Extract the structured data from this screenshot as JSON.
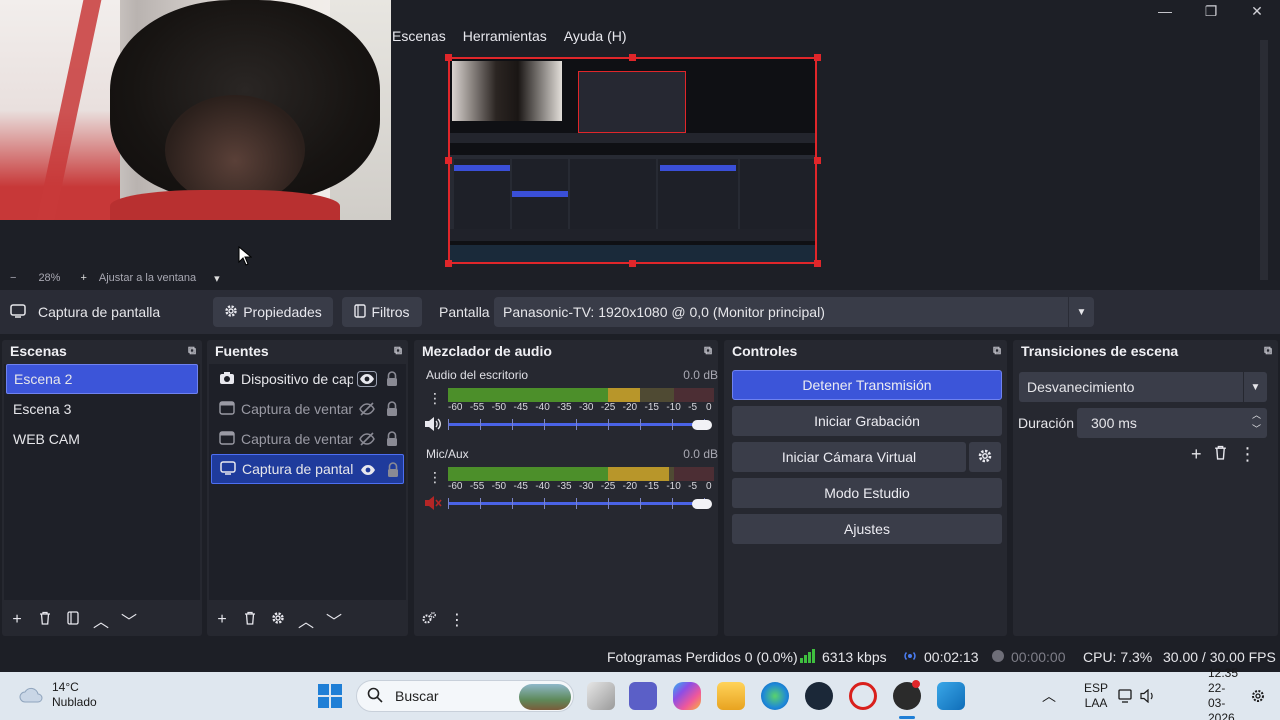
{
  "window": {
    "controls": [
      "—",
      "❐",
      "✕"
    ]
  },
  "menu": [
    "Escenas",
    "Herramientas",
    "Ayuda (H)"
  ],
  "zoom": {
    "minus": "−",
    "percent": "28%",
    "plus": "+",
    "fit": "Ajustar a la ventana",
    "dropdown": "▾"
  },
  "source_toolbar": {
    "source_name": "Captura de pantalla",
    "properties": "Propiedades",
    "filters": "Filtros",
    "display_label": "Pantalla",
    "display_value": "Panasonic-TV: 1920x1080 @ 0,0 (Monitor principal)"
  },
  "scenes": {
    "title": "Escenas",
    "items": [
      {
        "label": "Escena 2",
        "selected": true
      },
      {
        "label": "Escena 3",
        "selected": false
      },
      {
        "label": "WEB CAM",
        "selected": false
      }
    ]
  },
  "sources": {
    "title": "Fuentes",
    "items": [
      {
        "label": "Dispositivo de captura de vídeo",
        "visible": true,
        "icon": "camera-icon",
        "selected": false
      },
      {
        "label": "Captura de ventana",
        "visible": false,
        "icon": "window-icon",
        "selected": false
      },
      {
        "label": "Captura de ventana",
        "visible": false,
        "icon": "window-icon",
        "selected": false
      },
      {
        "label": "Captura de pantalla",
        "visible": true,
        "icon": "monitor-icon",
        "selected": true
      }
    ]
  },
  "mixer": {
    "title": "Mezclador de audio",
    "channels": [
      {
        "name": "Audio del escritorio",
        "db": "0.0 dB",
        "level": 0.72,
        "muted": false
      },
      {
        "name": "Mic/Aux",
        "db": "0.0 dB",
        "level": 0.83,
        "muted": true
      }
    ],
    "scale": [
      "-60",
      "-55",
      "-50",
      "-45",
      "-40",
      "-35",
      "-30",
      "-25",
      "-20",
      "-15",
      "-10",
      "-5",
      "0"
    ]
  },
  "controls": {
    "title": "Controles",
    "stop_stream": "Detener Transmisión",
    "start_recording": "Iniciar Grabación",
    "start_virtual_cam": "Iniciar Cámara Virtual",
    "studio_mode": "Modo Estudio",
    "settings": "Ajustes"
  },
  "transitions": {
    "title": "Transiciones de escena",
    "selected": "Desvanecimiento",
    "duration_label": "Duración",
    "duration_value": "300 ms"
  },
  "status": {
    "dropped_frames": "Fotogramas Perdidos 0 (0.0%)",
    "bitrate": "6313 kbps",
    "stream_time": "00:02:13",
    "record_time": "00:00:00",
    "cpu": "CPU: 7.3%",
    "fps": "30.00 / 30.00 FPS"
  },
  "taskbar": {
    "weather_temp": "14°C",
    "weather_desc": "Nublado",
    "search_placeholder": "Buscar",
    "language": "ESP",
    "layout": "LAA",
    "time": "12:35",
    "date": "22-03-2026"
  },
  "colors": {
    "accent": "#3c55d9",
    "selection_border": "#e0262a",
    "background": "#1d1f26"
  }
}
